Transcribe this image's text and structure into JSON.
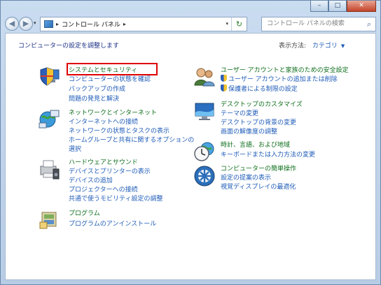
{
  "window": {
    "buttons": [
      "–",
      "□",
      "✕"
    ]
  },
  "nav": {
    "back_glyph": "◀",
    "forward_glyph": "▶",
    "address_crumbs": [
      "コントロール パネル"
    ],
    "search_placeholder": "コントロール パネルの検索"
  },
  "header": {
    "title": "コンピューターの設定を調整します",
    "view_by_label": "表示方法:",
    "view_by_value": "カテゴリ"
  },
  "categories": [
    {
      "title": "システムとセキュリティ",
      "icon": "shield-pc-icon",
      "links": [
        "コンピューターの状態を確認",
        "バックアップの作成",
        "問題の発見と解決"
      ]
    },
    {
      "title": "ネットワークとインターネット",
      "icon": "network-globe-icon",
      "links": [
        "インターネットへの接続",
        "ネットワークの状態とタスクの表示",
        "ホームグループと共有に関するオプションの",
        "選択"
      ]
    },
    {
      "title": "ハードウェアとサウンド",
      "icon": "printer-speaker-icon",
      "links": [
        "デバイスとプリンターの表示",
        "デバイスの追加",
        "プロジェクターへの接続",
        "共通で使うモビリティ設定の調整"
      ]
    },
    {
      "title": "プログラム",
      "icon": "programs-icon",
      "links": [
        "プログラムのアンインストール"
      ]
    },
    {
      "title": "ユーザー アカウントと家族のための安全設定",
      "icon": "users-icon",
      "links": [
        "ユーザー アカウントの追加または削除",
        "保護者による制限の設定"
      ]
    },
    {
      "title": "デスクトップのカスタマイズ",
      "icon": "desktop-icon",
      "links": [
        "テーマの変更",
        "デスクトップの背景の変更",
        "画面の解像度の調整"
      ]
    },
    {
      "title": "時計、言語、および地域",
      "icon": "clock-globe-icon",
      "links": [
        "キーボードまたは入力方法の変更"
      ]
    },
    {
      "title": "コンピューターの簡単操作",
      "icon": "ease-of-access-icon",
      "links": [
        "設定の提案の表示",
        "視覚ディスプレイの最適化"
      ]
    }
  ],
  "colors": {
    "category_title": "#0d6e1b",
    "link": "#1e5bb8",
    "highlight_box": "#e00000"
  }
}
